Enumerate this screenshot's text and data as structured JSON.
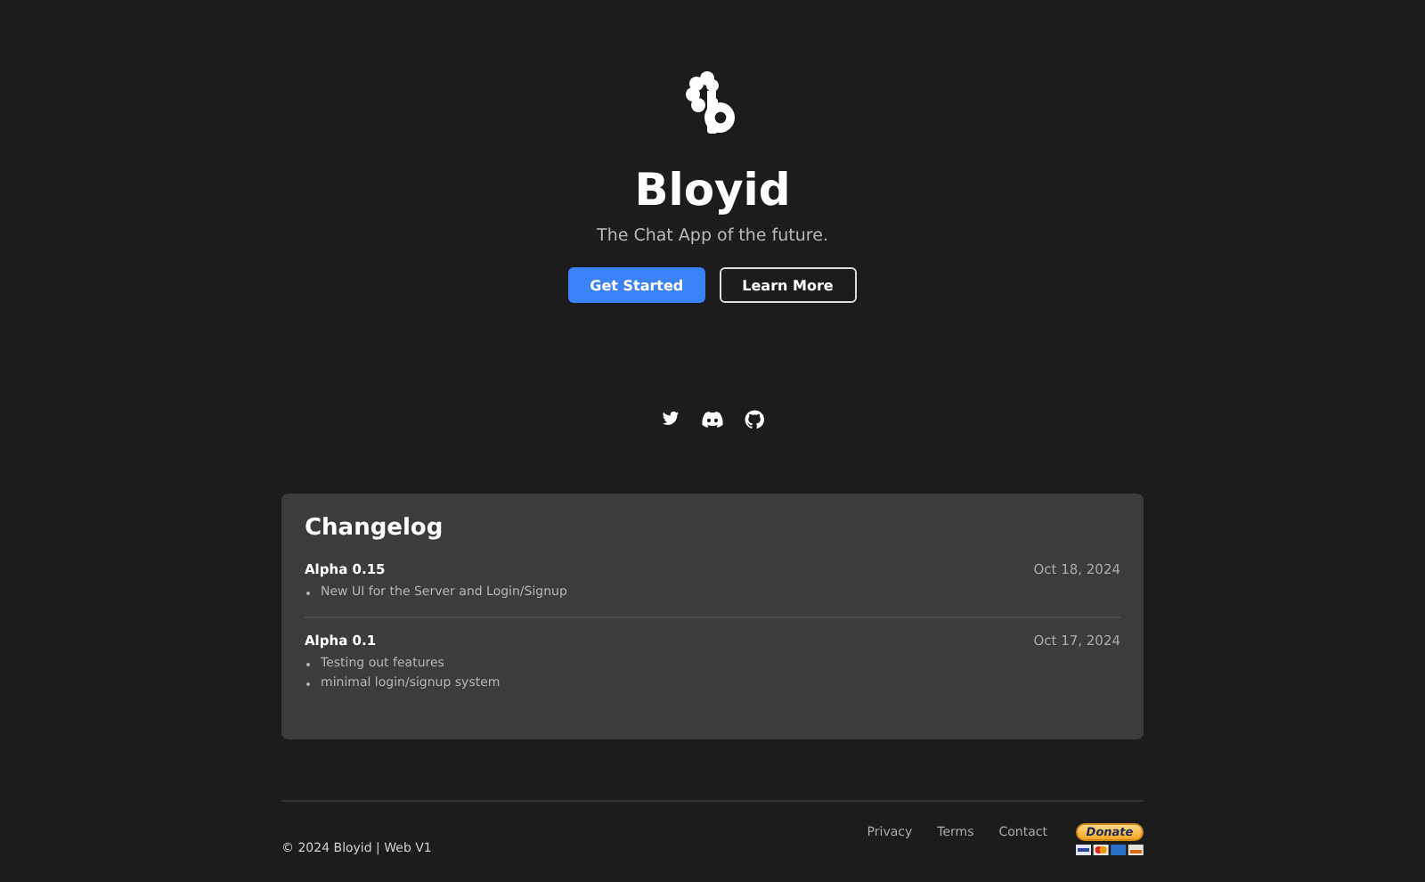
{
  "hero": {
    "title": "Bloyid",
    "subtitle": "The Chat App of the future.",
    "buttons": [
      {
        "label": "Get Started",
        "kind": "primary"
      },
      {
        "label": "Learn More",
        "kind": "outline"
      }
    ]
  },
  "social_links": [
    {
      "kind": "twitter"
    },
    {
      "kind": "discord"
    },
    {
      "kind": "github"
    }
  ],
  "changelog": {
    "title": "Changelog",
    "entries": [
      {
        "version": "Alpha 0.15",
        "date": "Oct 18, 2024",
        "items": [
          "New UI for the Server and Login/Signup"
        ]
      },
      {
        "version": "Alpha 0.1",
        "date": "Oct 17, 2024",
        "items": [
          "Testing out features",
          "minimal login/signup system"
        ]
      }
    ]
  },
  "footer": {
    "copyright": "© 2024 Bloyid | Web V1",
    "links": [
      "Privacy",
      "Terms",
      "Contact"
    ],
    "donate": {
      "label": "Donate"
    }
  }
}
